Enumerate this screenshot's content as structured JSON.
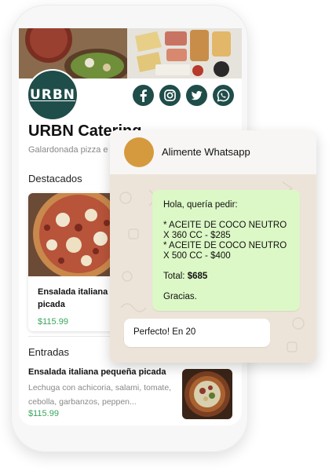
{
  "store": {
    "logo_text": "URBN",
    "name": "URBN Catering",
    "tagline": "Galardonada pizza e",
    "brand_color": "#1f4d4a",
    "price_color": "#3aa55b"
  },
  "socials": [
    "facebook-icon",
    "instagram-icon",
    "twitter-icon",
    "whatsapp-icon"
  ],
  "featured": {
    "heading": "Destacados",
    "card": {
      "name": "Ensalada italiana picada",
      "price": "$115.99"
    }
  },
  "starters": {
    "heading": "Entradas",
    "item": {
      "name": "Ensalada italiana pequeña picada",
      "description": "Lechuga con achicoria, salami, tomate, cebolla, garbanzos, peppen...",
      "price": "$115.99"
    }
  },
  "whatsapp": {
    "contact_name": "Alimente Whatsapp",
    "avatar_color": "#d59a3d",
    "outgoing": {
      "greeting": "Hola, quería pedir:",
      "line1": "* ACEITE DE COCO NEUTRO",
      "line2": "X 360 CC - $285",
      "line3": "* ACEITE DE COCO NEUTRO",
      "line4": "X 500 CC - $400",
      "total_label": "Total:",
      "total_value": "$685",
      "closing": "Gracias."
    },
    "incoming": {
      "text": "Perfecto! En 20"
    }
  }
}
